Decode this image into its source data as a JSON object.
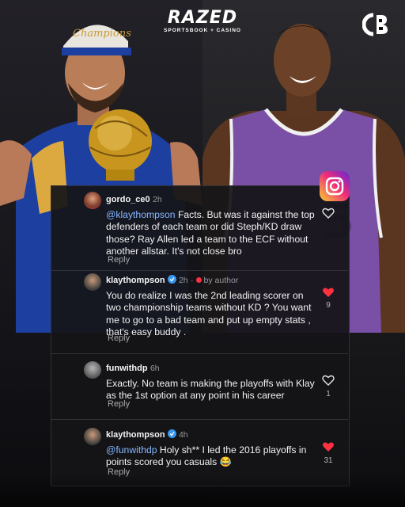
{
  "brand": {
    "name": "RAZED",
    "tagline": "SPORTSBOOK + CASINO"
  },
  "icons": {
    "top_right_logo": "cb-logo-icon",
    "platform": "instagram-icon",
    "heart_outline": "heart-outline-icon",
    "heart_filled": "heart-filled-icon",
    "verified": "verified-badge-icon"
  },
  "colors": {
    "liked_heart": "#ff3040",
    "mention": "#86b7ff",
    "verified": "#3897f0"
  },
  "comments": [
    {
      "username": "gordo_ce0",
      "time": "2h",
      "mention": "@klaythompson",
      "text": " Facts. But was it against the top defenders of each team or did Steph/KD draw those? Ray Allen led a team to the ECF without another allstar. It's not close bro",
      "reply_label": "Reply",
      "liked": false
    },
    {
      "username": "klaythompson",
      "time": "2h",
      "author_tag": "by author",
      "text": "You do realize I was the 2nd leading scorer on two championship teams without KD ? You want me to go to a bad team and put up empty stats , that's easy buddy .",
      "reply_label": "Reply",
      "liked": true,
      "likes": "9"
    },
    {
      "username": "funwithdp",
      "time": "6h",
      "text": "Exactly. No team is making the playoffs with Klay as the 1st option at any point in his career",
      "reply_label": "Reply",
      "liked": false,
      "likes": "1"
    },
    {
      "username": "klaythompson",
      "time": "4h",
      "mention": "@funwithdp",
      "text": " Holy sh** I led the 2016 playoffs in points scored you casuals 😂",
      "reply_label": "Reply",
      "liked": true,
      "likes": "31"
    }
  ]
}
